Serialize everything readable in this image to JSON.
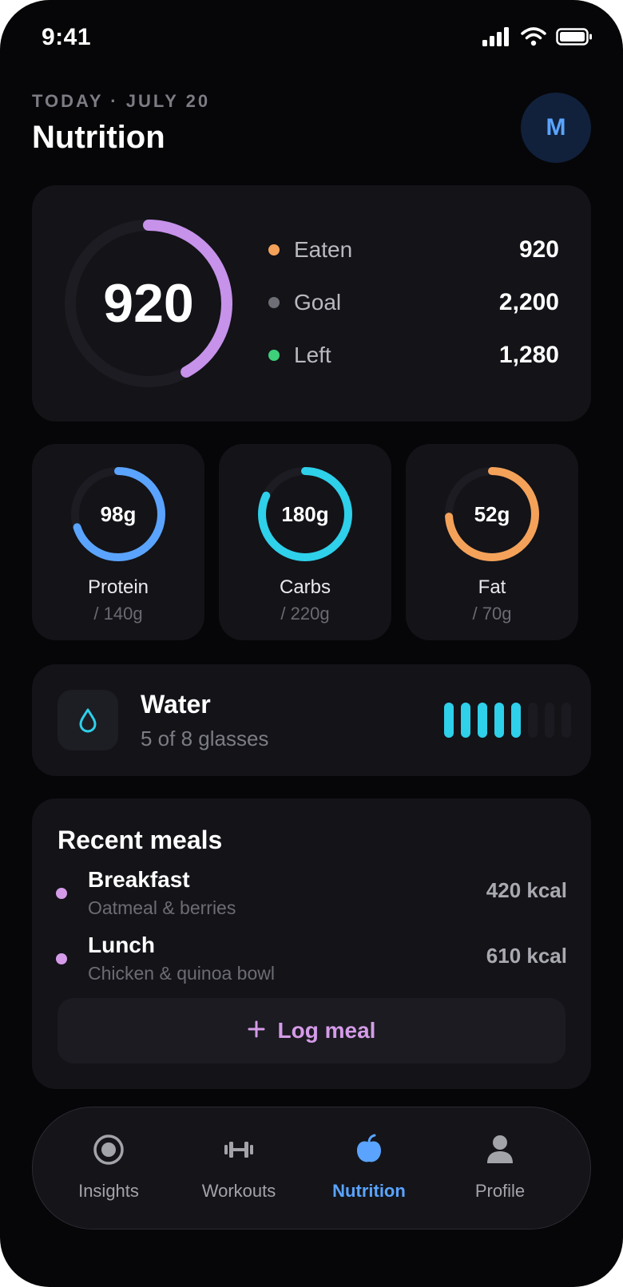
{
  "status_bar": {
    "time": "9:41"
  },
  "header": {
    "date_label": "TODAY · JULY 20",
    "title": "Nutrition",
    "avatar_initial": "M"
  },
  "calories": {
    "eaten_display": "920",
    "progress_fraction": 0.42,
    "ring_color": "#c792ea",
    "stats": [
      {
        "label": "Eaten",
        "value": "920",
        "dot_color": "#f4a259"
      },
      {
        "label": "Goal",
        "value": "2,200",
        "dot_color": "#6e6e76"
      },
      {
        "label": "Left",
        "value": "1,280",
        "dot_color": "#3ecf7a"
      }
    ]
  },
  "macros": [
    {
      "amount": "98g",
      "name": "Protein",
      "goal": "/ 140g",
      "color": "#5aa4ff",
      "progress": 0.7
    },
    {
      "amount": "180g",
      "name": "Carbs",
      "goal": "/ 220g",
      "color": "#2ed0ea",
      "progress": 0.82
    },
    {
      "amount": "52g",
      "name": "Fat",
      "goal": "/ 70g",
      "color": "#f4a259",
      "progress": 0.74
    }
  ],
  "water": {
    "title": "Water",
    "subtitle": "5 of 8 glasses",
    "filled": 5,
    "total": 8,
    "color": "#2ed0ea"
  },
  "meals": {
    "title": "Recent meals",
    "items": [
      {
        "name": "Breakfast",
        "description": "Oatmeal & berries",
        "kcal": "420 kcal"
      },
      {
        "name": "Lunch",
        "description": "Chicken & quinoa bowl",
        "kcal": "610 kcal"
      }
    ],
    "log_button": {
      "icon": "plus-icon",
      "label": "Log meal"
    }
  },
  "tab_bar": {
    "active": "Nutrition",
    "tabs": [
      {
        "label": "Insights",
        "icon": "target-icon"
      },
      {
        "label": "Workouts",
        "icon": "dumbbell-icon"
      },
      {
        "label": "Nutrition",
        "icon": "apple-icon"
      },
      {
        "label": "Profile",
        "icon": "person-icon"
      }
    ]
  }
}
